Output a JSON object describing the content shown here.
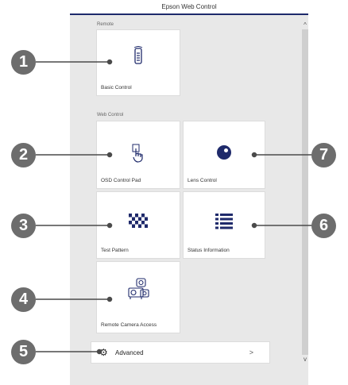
{
  "window": {
    "title": "Epson Web Control"
  },
  "sections": {
    "remote_label": "Remote",
    "web_control_label": "Web Control"
  },
  "tiles": {
    "basic_control": "Basic Control",
    "osd_control_pad": "OSD Control Pad",
    "lens_control": "Lens Control",
    "test_pattern": "Test Pattern",
    "status_information": "Status Information",
    "remote_camera_access": "Remote Camera Access"
  },
  "advanced": {
    "label": "Advanced",
    "chevron": ">"
  },
  "scrollbar": {
    "up": "^",
    "down": "v"
  },
  "callouts": [
    "1",
    "2",
    "3",
    "4",
    "5",
    "6",
    "7"
  ],
  "colors": {
    "header_rule": "#1d2a6b",
    "panel_bg": "#e8e8e8",
    "callout_bg": "#6d6d6d"
  }
}
